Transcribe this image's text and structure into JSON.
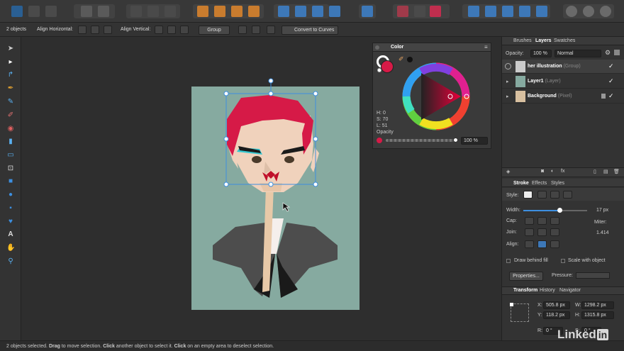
{
  "status": {
    "selected_count": "2 objects",
    "message_parts": [
      "2 objects selected. ",
      "Drag",
      " to move selection. ",
      "Click",
      " another object to select it. ",
      "Click",
      " on an empty area to deselect selection."
    ]
  },
  "context_toolbar": {
    "align_horizontal": "Align Horizontal:",
    "align_vertical": "Align Vertical:",
    "group": "Group",
    "convert_to_curves": "Convert to Curves"
  },
  "color_panel": {
    "title": "Color",
    "h": "H: 0",
    "s": "S: 70",
    "l": "L: 51",
    "opacity_label": "Opacity",
    "opacity_value": "100 %",
    "current_color": "#d61a47"
  },
  "right_panel": {
    "tabs": [
      "Brushes",
      "Layers",
      "Swatches"
    ],
    "opacity_label": "Opacity:",
    "opacity_value": "100 %",
    "blend_mode": "Normal",
    "layers": [
      {
        "name": "her illustration",
        "type": "(Group)"
      },
      {
        "name": "Layer1",
        "type": "(Layer)"
      },
      {
        "name": "Background",
        "type": "(Pixel)"
      }
    ],
    "stroke_tabs": [
      "Stroke",
      "Effects",
      "Styles"
    ],
    "style_label": "Style:",
    "width_label": "Width:",
    "width_value": "17 px",
    "cap_label": "Cap:",
    "join_label": "Join:",
    "align_label": "Align:",
    "miter_label": "Miter:",
    "miter_value": "1.414",
    "draw_behind_fill": "Draw behind fill",
    "scale_with_object": "Scale with object",
    "properties": "Properties...",
    "pressure": "Pressure:",
    "transform_tabs": [
      "Transform",
      "History",
      "Navigator"
    ],
    "x_label": "X:",
    "x_value": "505.8 px",
    "y_label": "Y:",
    "y_value": "118.2 px",
    "w_label": "W:",
    "w_value": "1298.2 px",
    "h_label": "H:",
    "h_value": "1315.8 px",
    "r_label": "R:",
    "r_value": "0 °",
    "s_label": "S:",
    "s_value": "0 °"
  },
  "watermark": "Linked",
  "watermark_in": "in",
  "colors": {
    "hair": "#d61a47",
    "skin": "#f0d2bc",
    "canvas": "#86aaa0",
    "jacket": "#4d4d4d",
    "selection": "#3d8fe0",
    "cyan": "#35c7d0"
  }
}
